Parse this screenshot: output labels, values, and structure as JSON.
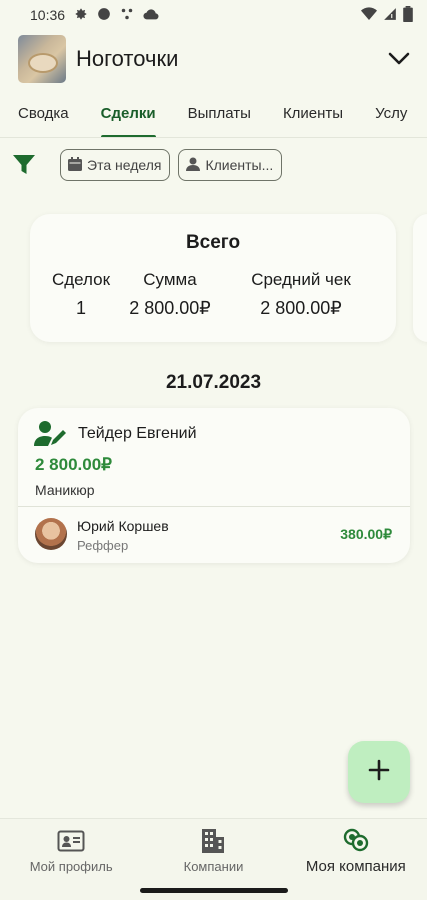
{
  "status_bar": {
    "time": "10:36",
    "icons_left": [
      "gear-icon",
      "circle-icon",
      "hub-icon",
      "cloud-icon"
    ],
    "icons_right": [
      "wifi-icon",
      "signal-icon",
      "battery-icon"
    ]
  },
  "app_bar": {
    "title": "Ноготочки",
    "logo_icon": "company-photo",
    "menu_icon": "chevron-down-icon"
  },
  "tabs": [
    {
      "label": "Сводка",
      "active": false
    },
    {
      "label": "Сделки",
      "active": true
    },
    {
      "label": "Выплаты",
      "active": false
    },
    {
      "label": "Клиенты",
      "active": false
    },
    {
      "label": "Услу",
      "active": false
    }
  ],
  "filters": {
    "period_chip": "Эта неделя",
    "clients_chip": "Клиенты..."
  },
  "summary": {
    "title": "Всего",
    "deals_label": "Сделок",
    "deals_value": "1",
    "sum_label": "Сумма",
    "sum_value": "2 800.00₽",
    "avg_label": "Средний чек",
    "avg_value": "2 800.00₽"
  },
  "date_group": "21.07.2023",
  "deal": {
    "client_name": "Тейдер Евгений",
    "amount": "2 800.00₽",
    "service": "Маникюр",
    "referrer_name": "Юрий Коршев",
    "referrer_role": "Реффер",
    "referrer_amount": "380.00₽"
  },
  "bottom_nav": [
    {
      "label": "Мой профиль",
      "icon": "id-card-icon",
      "active": false
    },
    {
      "label": "Компании",
      "icon": "building-icon",
      "active": false
    },
    {
      "label": "Моя компания",
      "icon": "coins-icon",
      "active": true
    }
  ],
  "colors": {
    "accent": "#1e6b2e",
    "amount_green": "#2e8a3b",
    "fab": "#bfeec0",
    "background": "#f6f8ee"
  }
}
